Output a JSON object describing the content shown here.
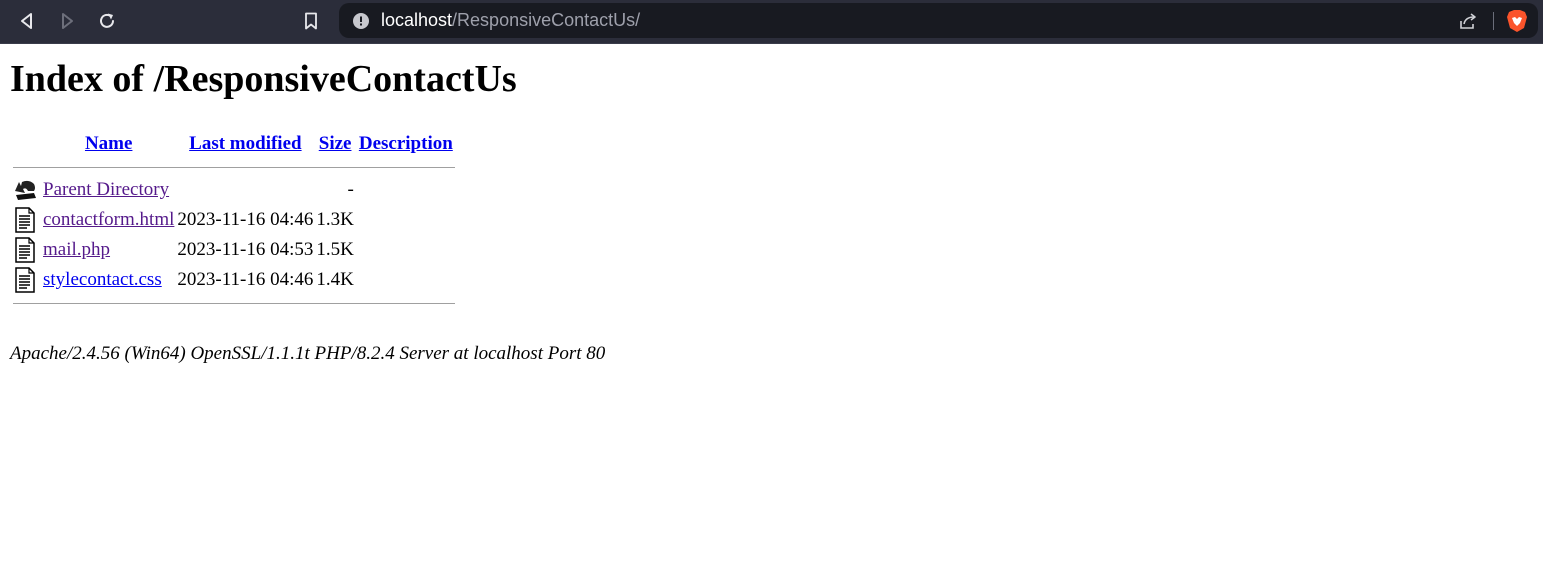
{
  "browser": {
    "url_host": "localhost",
    "url_path": "/ResponsiveContactUs/",
    "icons": [
      "back-icon",
      "forward-icon",
      "reload-icon",
      "bookmark-icon",
      "info-icon",
      "share-icon",
      "brave-lion-icon"
    ]
  },
  "page": {
    "title": "Index of /ResponsiveContactUs",
    "columns": [
      "Name",
      "Last modified",
      "Size",
      "Description"
    ],
    "parent": {
      "name": "Parent Directory",
      "size": "-"
    },
    "files": [
      {
        "name": "contactform.html",
        "modified": "2023-11-16 04:46",
        "size": "1.3K",
        "description": ""
      },
      {
        "name": "mail.php",
        "modified": "2023-11-16 04:53",
        "size": "1.5K",
        "description": ""
      },
      {
        "name": "stylecontact.css",
        "modified": "2023-11-16 04:46",
        "size": "1.4K",
        "description": ""
      }
    ],
    "server_signature": "Apache/2.4.56 (Win64) OpenSSL/1.1.1t PHP/8.2.4 Server at localhost Port 80"
  },
  "colors": {
    "toolbar": "#2b2d3a",
    "urlbar": "#181a21",
    "link": "#0000ee",
    "visited_link": "#551a8b",
    "brave": "#fb542b"
  }
}
